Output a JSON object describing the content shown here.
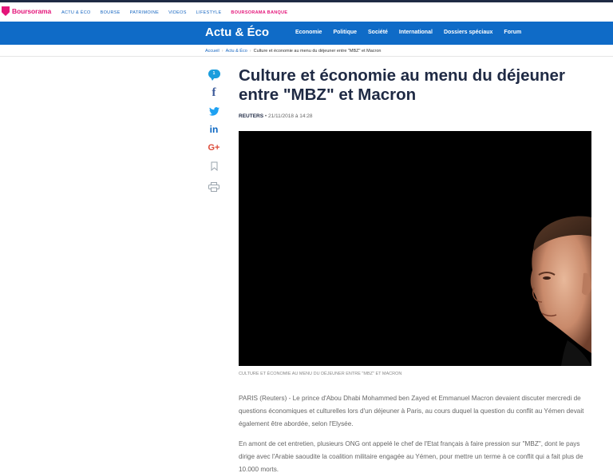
{
  "topbar": {
    "brand": "Boursorama",
    "nav": [
      "ACTU & ÉCO",
      "BOURSE",
      "PATRIMOINE",
      "VIDEOS",
      "LIFESTYLE"
    ],
    "banque": "BOURSORAMA BANQUE"
  },
  "header": {
    "section_title": "Actu & Éco",
    "nav": [
      "Economie",
      "Politique",
      "Société",
      "International",
      "Dossiers spéciaux",
      "Forum"
    ]
  },
  "breadcrumb": {
    "items": [
      "Accueil",
      "Actu & Éco"
    ],
    "current": "Culture et économie au menu du déjeuner entre \"MBZ\" et Macron"
  },
  "share": {
    "comment_count": "1",
    "icons": [
      "comment-icon",
      "facebook-icon",
      "twitter-icon",
      "linkedin-icon",
      "google-plus-icon",
      "bookmark-icon",
      "print-icon"
    ]
  },
  "article": {
    "title": "Culture et économie au menu du déjeuner entre \"MBZ\" et Macron",
    "source": "REUTERS",
    "separator": "•",
    "date": "21/11/2018 à 14:28",
    "caption": "CULTURE ET ÉCONOMIE AU MENU DU DÉJEUNER ENTRE \"MBZ\" ET MACRON",
    "paragraphs": [
      "PARIS (Reuters) - Le prince d'Abou Dhabi Mohammed ben Zayed et Emmanuel Macron devaient discuter mercredi de questions économiques et culturelles lors d'un déjeuner à Paris, au cours duquel la question du conflit au Yémen devait également être abordée, selon l'Elysée.",
      "En amont de cet entretien, plusieurs ONG ont appelé le chef de l'Etat français à faire pression sur \"MBZ\", dont le pays dirige avec l'Arabie saoudite la coalition militaire engagée au Yémen, pour mettre un terme à ce conflit qui a fait plus de 10.000 morts."
    ]
  },
  "colors": {
    "brand": "#e4157a",
    "header_blue": "#0f6bc7",
    "title": "#1f2a44",
    "link": "#1565c0"
  }
}
